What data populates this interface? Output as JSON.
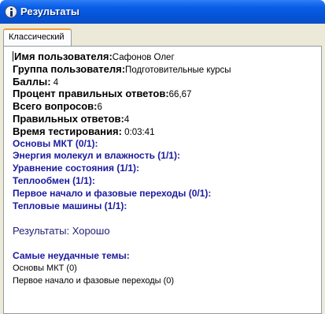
{
  "window": {
    "title": "Результаты"
  },
  "tabs": [
    {
      "label": "Классический"
    }
  ],
  "fields": [
    {
      "label": "Имя пользователя:",
      "value": "Сафонов Олег"
    },
    {
      "label": "Группа пользователя:",
      "value": "Подготовительные курсы"
    },
    {
      "label": "Баллы:",
      "value": " 4"
    },
    {
      "label": "Процент правильных ответов:",
      "value": "66,67"
    },
    {
      "label": "Всего вопросов:",
      "value": "6"
    },
    {
      "label": "Правильных ответов:",
      "value": "4"
    },
    {
      "label": "Время тестирования:",
      "value": " 0:03:41"
    }
  ],
  "topics": [
    "Основы МКТ (0/1):",
    "Энергия молекул и влажность (1/1):",
    "Уравнение состояния (1/1):",
    "Теплообмен (1/1):",
    "Первое начало и фазовые переходы  (0/1):",
    "Тепловые машины (1/1):"
  ],
  "result": "Результаты: Хорошо",
  "worst": {
    "heading": "Самые неудачные темы:",
    "items": [
      "Основы МКТ (0)",
      "Первое начало и фазовые переходы  (0)"
    ]
  }
}
